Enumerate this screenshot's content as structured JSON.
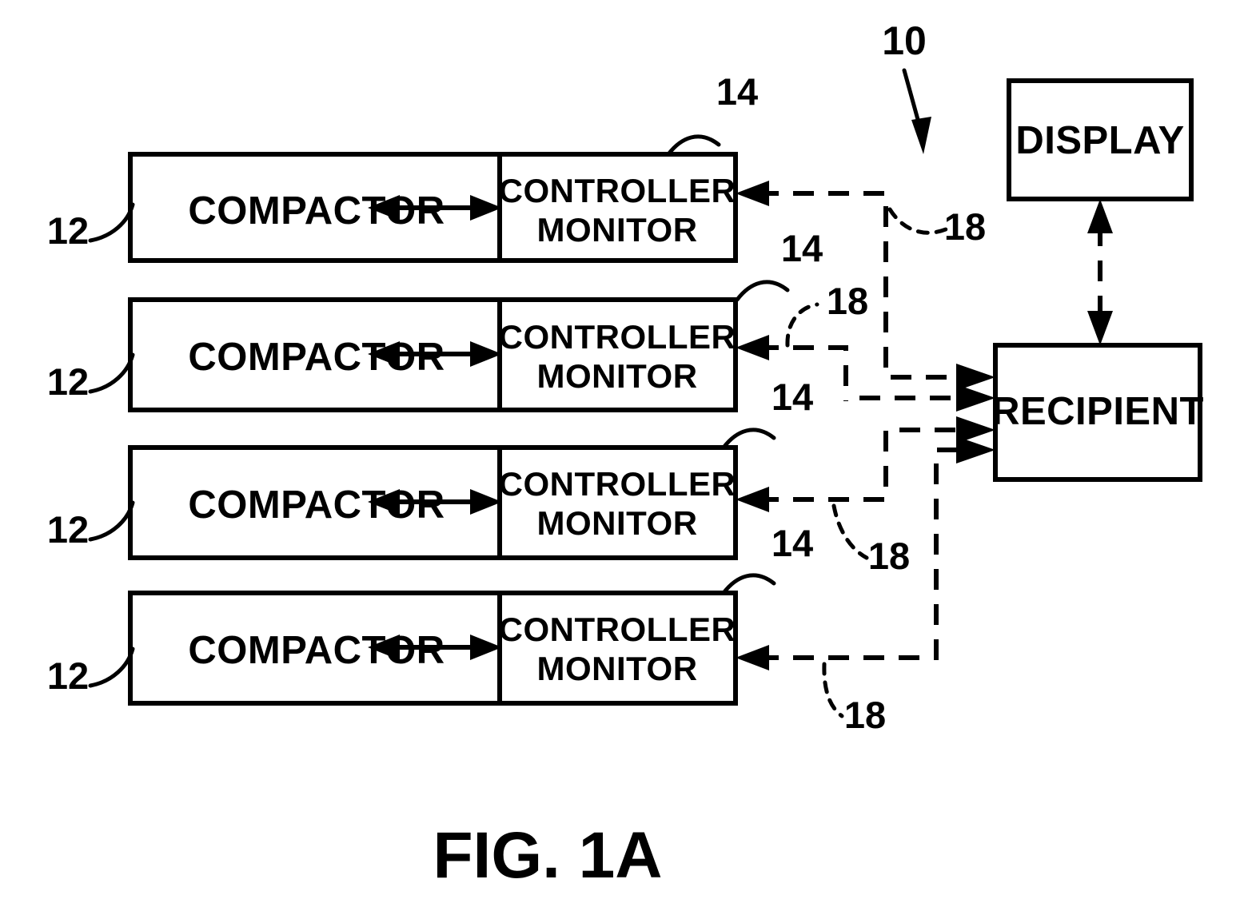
{
  "figure": {
    "caption": "FIG. 1A",
    "system_reference": "10"
  },
  "boxes": {
    "compactor_label": "COMPACTOR",
    "controller_line1": "CONTROLLER",
    "controller_line2": "MONITOR",
    "display_label": "DISPLAY",
    "recipient_label": "RECIPIENT"
  },
  "reference_numerals": {
    "compactor": "12",
    "controller_monitor": "14",
    "communication_link": "18",
    "system": "10"
  },
  "rows": [
    {
      "index": 1,
      "compactor_label": "COMPACTOR",
      "compactor_ref": "12",
      "controller_line1": "CONTROLLER",
      "controller_line2": "MONITOR",
      "controller_ref": "14",
      "link_ref": "18"
    },
    {
      "index": 2,
      "compactor_label": "COMPACTOR",
      "compactor_ref": "12",
      "controller_line1": "CONTROLLER",
      "controller_line2": "MONITOR",
      "controller_ref": "14",
      "link_ref": "18"
    },
    {
      "index": 3,
      "compactor_label": "COMPACTOR",
      "compactor_ref": "12",
      "controller_line1": "CONTROLLER",
      "controller_line2": "MONITOR",
      "controller_ref": "14",
      "link_ref": "18"
    },
    {
      "index": 4,
      "compactor_label": "COMPACTOR",
      "compactor_ref": "12",
      "controller_line1": "CONTROLLER",
      "controller_line2": "MONITOR",
      "controller_ref": "14",
      "link_ref": "18"
    }
  ],
  "colors": {
    "ink": "#000000",
    "paper": "#ffffff"
  }
}
